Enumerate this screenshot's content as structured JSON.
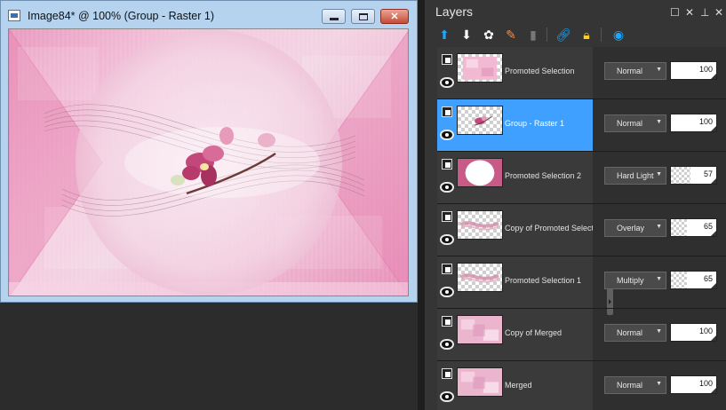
{
  "image_window": {
    "title": "Image84* @ 100% (Group - Raster 1)",
    "buttons": {
      "minimize": "minimize-icon",
      "maximize": "maximize-icon",
      "close": "close-icon"
    }
  },
  "layers_panel": {
    "title": "Layers",
    "header_icons": [
      "window-icon",
      "close-icon",
      "pin-icon",
      "panel-close-icon"
    ],
    "toolbar": [
      "new-raster-layer-icon",
      "new-vector-layer-icon",
      "new-adjustment-layer-icon",
      "edit-selection-icon",
      "delete-layer-icon",
      "link-icon",
      "lock-icon",
      "layer-visibility-icon"
    ],
    "layers": [
      {
        "name": "Promoted Selection",
        "blend": "Normal",
        "opacity": "100",
        "opacity_fraction": 1.0,
        "selected": false,
        "thumb": "pink-tiles"
      },
      {
        "name": "Group - Raster 1",
        "blend": "Normal",
        "opacity": "100",
        "opacity_fraction": 1.0,
        "selected": true,
        "thumb": "flower"
      },
      {
        "name": "Promoted Selection 2",
        "blend": "Hard Light",
        "opacity": "57",
        "opacity_fraction": 0.57,
        "selected": false,
        "thumb": "circle"
      },
      {
        "name": "Copy of Promoted Selection",
        "blend": "Overlay",
        "opacity": "65",
        "opacity_fraction": 0.65,
        "selected": false,
        "thumb": "wave"
      },
      {
        "name": "Promoted Selection 1",
        "blend": "Multiply",
        "opacity": "65",
        "opacity_fraction": 0.65,
        "selected": false,
        "thumb": "wave"
      },
      {
        "name": "Copy of Merged",
        "blend": "Normal",
        "opacity": "100",
        "opacity_fraction": 1.0,
        "selected": false,
        "thumb": "merged"
      },
      {
        "name": "Merged",
        "blend": "Normal",
        "opacity": "100",
        "opacity_fraction": 1.0,
        "selected": false,
        "thumb": "merged"
      }
    ]
  },
  "colors": {
    "selection": "#3fa0ff",
    "panel_bg": "#353535",
    "canvas_pink": "#f0bcd4",
    "window_frame": "#b5d3ee"
  }
}
